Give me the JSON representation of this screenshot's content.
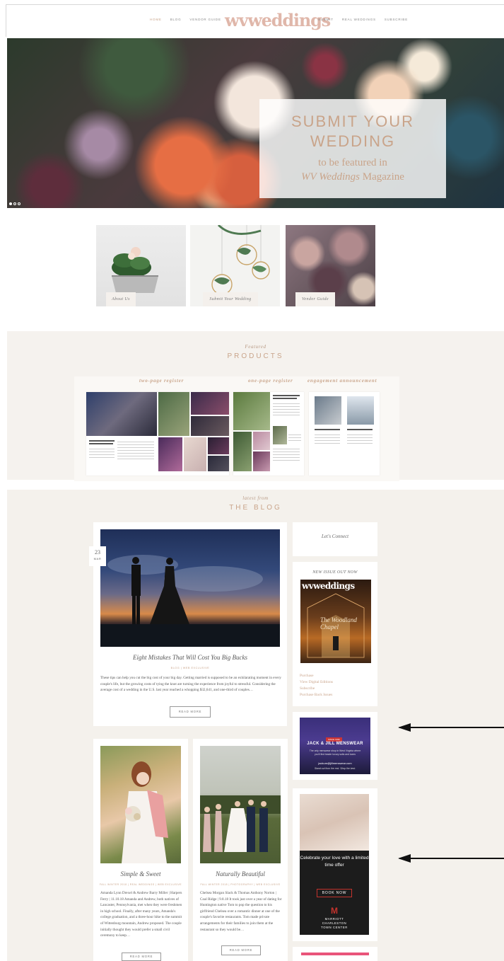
{
  "header": {
    "logo": "wvweddings",
    "nav_left": [
      "HOME",
      "BLOG",
      "VENDOR GUIDE"
    ],
    "nav_right": [
      "SUBMIT",
      "REAL WEDDINGS",
      "SUBSCRIBE"
    ]
  },
  "hero": {
    "title": "SUBMIT YOUR\nWEDDING",
    "subtitle": "to be featured in",
    "subtitle_em": "WV Weddings",
    "subtitle_end": " Magazine"
  },
  "tiles": [
    "About Us",
    "Submit Your Wedding",
    "Vendor Guide"
  ],
  "products": {
    "kicker": "Featured",
    "title": "PRODUCTS",
    "labels": [
      "two-page register",
      "one-page register",
      "engagement announcement"
    ]
  },
  "blog": {
    "kicker": "latest from",
    "title": "THE BLOG",
    "featured": {
      "date_day": "23",
      "date_month": "MAR",
      "title": "Eight Mistakes That Will Cost You Big Bucks",
      "categories": "BLOG   |   WEB EXCLUSIVE",
      "excerpt": "These tips can help you cut the big cost of your big day. Getting married is supposed to be an exhilarating moment in every couple's life, but the growing costs of tying the knot are turning the experience from joyful to stressful. Considering the average cost of a wedding in the U.S. last year reached a whopping $32,641, and one-third of couples…",
      "read_more": "READ MORE"
    },
    "posts": [
      {
        "title": "Simple & Sweet",
        "categories": "FALL WINTER 2018  |  REAL WEDDINGS  |  WEB EXCLUSIVE",
        "excerpt": "Amanda Lynn Drexel & Andrew Barry Miller | Harpers Ferry | 11.10.18 Amanda and Andrew, both natives of Lancaster, Pennsylvania, met when they were freshmen in high school. Finally, after many years, Amanda's college graduation, and a three-hour hike to the summit of Wittenburg mountain, Andrew proposed. The couple initially thought they would prefer a small civil ceremony to keep…",
        "read_more": "READ MORE"
      },
      {
        "title": "Naturally Beautiful",
        "categories": "FALL WINTER 2018  |  PHOTOGRAPHY  |  WEB EXCLUSIVE",
        "excerpt": "Chelsea Morgan Slack & Thomas Anthony Norton | Coal Ridge | 9.8.18  It took just over a year of dating for Huntington native Tom to pop the question to his girlfriend Chelsea over a romantic dinner at one of the couple's favorite restaurants. Tom made private arrangements for their families to join them at the restaurant so they would be…",
        "read_more": "READ MORE"
      }
    ]
  },
  "sidebar": {
    "connect_title": "Let's Connect",
    "issue_title": "NEW ISSUE OUT NOW",
    "cover_logo": "wvweddings",
    "cover_script": "The Woodland Chapel",
    "links": [
      "Purchase",
      "View Digital Editions",
      "Subscribe",
      "Purchase Back Issues"
    ],
    "ad_jj": {
      "since": "SINCE 1996",
      "brand": "JACK & JILL MENSWEAR",
      "line1": "The only menswear shop in West Virginia where",
      "line2": "you'll find leader luxury suits and tuxes",
      "line3": "jackum@jillmenswear.com",
      "line4": "Stand out from the rest. Shop the best."
    },
    "ad_marriott": {
      "copy": "Celebrate your love with a limited time offer",
      "button": "BOOK NOW",
      "logo": "M",
      "name": "MARRIOTT\nCHARLESTON\nTOWN CENTER"
    }
  }
}
